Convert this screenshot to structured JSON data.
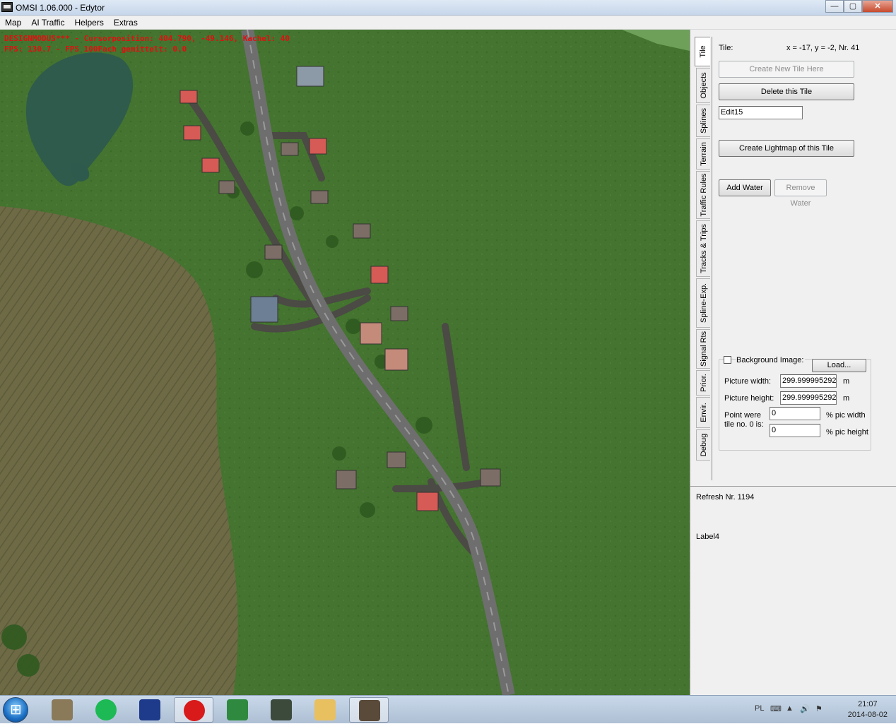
{
  "window": {
    "title": "OMSI 1.06.000 - Edytor",
    "buttons": {
      "minimize": "—",
      "maximize": "▢",
      "close": "✕"
    }
  },
  "menu": [
    "Map",
    "AI Traffic",
    "Helpers",
    "Extras"
  ],
  "viewport": {
    "overlay_line1": "DESIGNMODUS*** - Cursorposition: 404.790, -49.146, Kachel: 40",
    "overlay_line2": "FPS: 130.7 - FPS 100Fach gemittelt: 0.0"
  },
  "tabs": [
    "Tile",
    "Objects",
    "Splines",
    "Terrain",
    "Traffic Rules",
    "Tracks & Trips",
    "Spline-Exp.",
    "Signal Rts",
    "Prior.",
    "Envir.",
    "Debug"
  ],
  "active_tab": "Tile",
  "tile": {
    "tile_label": "Tile:",
    "tile_info": "x = -17, y = -2, Nr. 41",
    "create_button": "Create New Tile Here",
    "delete_button": "Delete this Tile",
    "edit_value": "Edit15",
    "lightmap_button": "Create Lightmap of this Tile",
    "add_water_button": "Add Water",
    "remove_water_button": "Remove Water",
    "background": {
      "checkbox_label": "Background Image:",
      "load_button": "Load...",
      "width_label": "Picture width:",
      "width_value": "299.999995292",
      "height_label": "Picture height:",
      "height_value": "299.999995292",
      "unit_m": "m",
      "point_label_1": "Point were",
      "point_label_2": "tile no. 0 is:",
      "point_x_value": "0",
      "point_y_value": "0",
      "pct_width_label": "% pic width",
      "pct_height_label": "% pic height"
    }
  },
  "refresh_label": "Refresh Nr. 1194",
  "label4": "Label4",
  "taskbar": {
    "apps": [
      "gimp-icon",
      "spotify-icon",
      "devcpp-icon",
      "opera-icon",
      "excel-icon",
      "terminal-icon",
      "explorer-icon",
      "omsi-icon"
    ],
    "tray_lang": "PL",
    "clock_time": "21:07",
    "clock_date": "2014-08-02"
  }
}
